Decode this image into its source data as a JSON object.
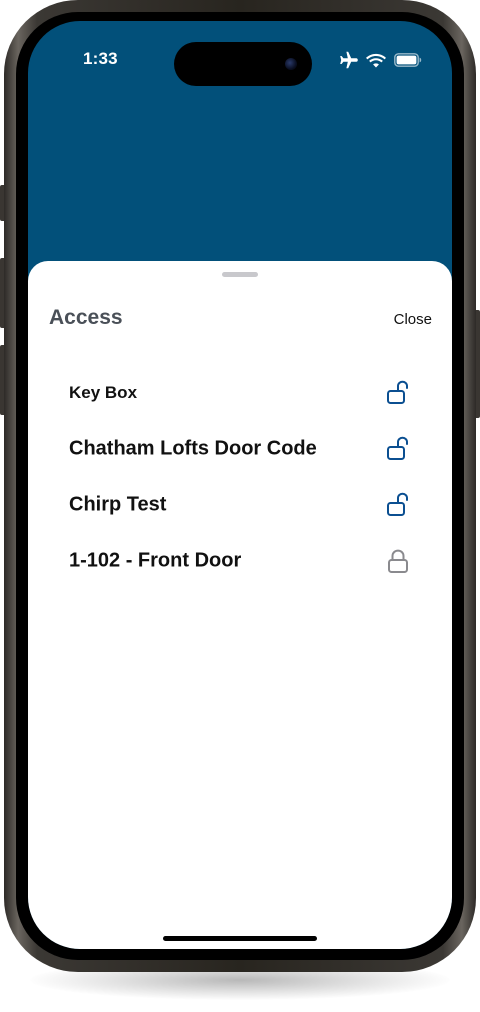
{
  "status_bar": {
    "time": "1:33",
    "icons": [
      "airplane-icon",
      "wifi-icon",
      "battery-icon"
    ]
  },
  "colors": {
    "header_background": "#02507a",
    "unlocked_icon": "#0b4f91",
    "locked_icon": "#8a8a8e",
    "title_text": "#4a5058"
  },
  "sheet": {
    "title": "Access",
    "close_label": "Close",
    "items": [
      {
        "label": "Key Box",
        "lock_state": "unlocked",
        "icon": "lock-open-icon"
      },
      {
        "label": "Chatham Lofts Door Code",
        "lock_state": "unlocked",
        "icon": "lock-open-icon"
      },
      {
        "label": "Chirp Test",
        "lock_state": "unlocked",
        "icon": "lock-open-icon"
      },
      {
        "label": "1-102 - Front Door",
        "lock_state": "locked",
        "icon": "lock-closed-icon"
      }
    ]
  }
}
